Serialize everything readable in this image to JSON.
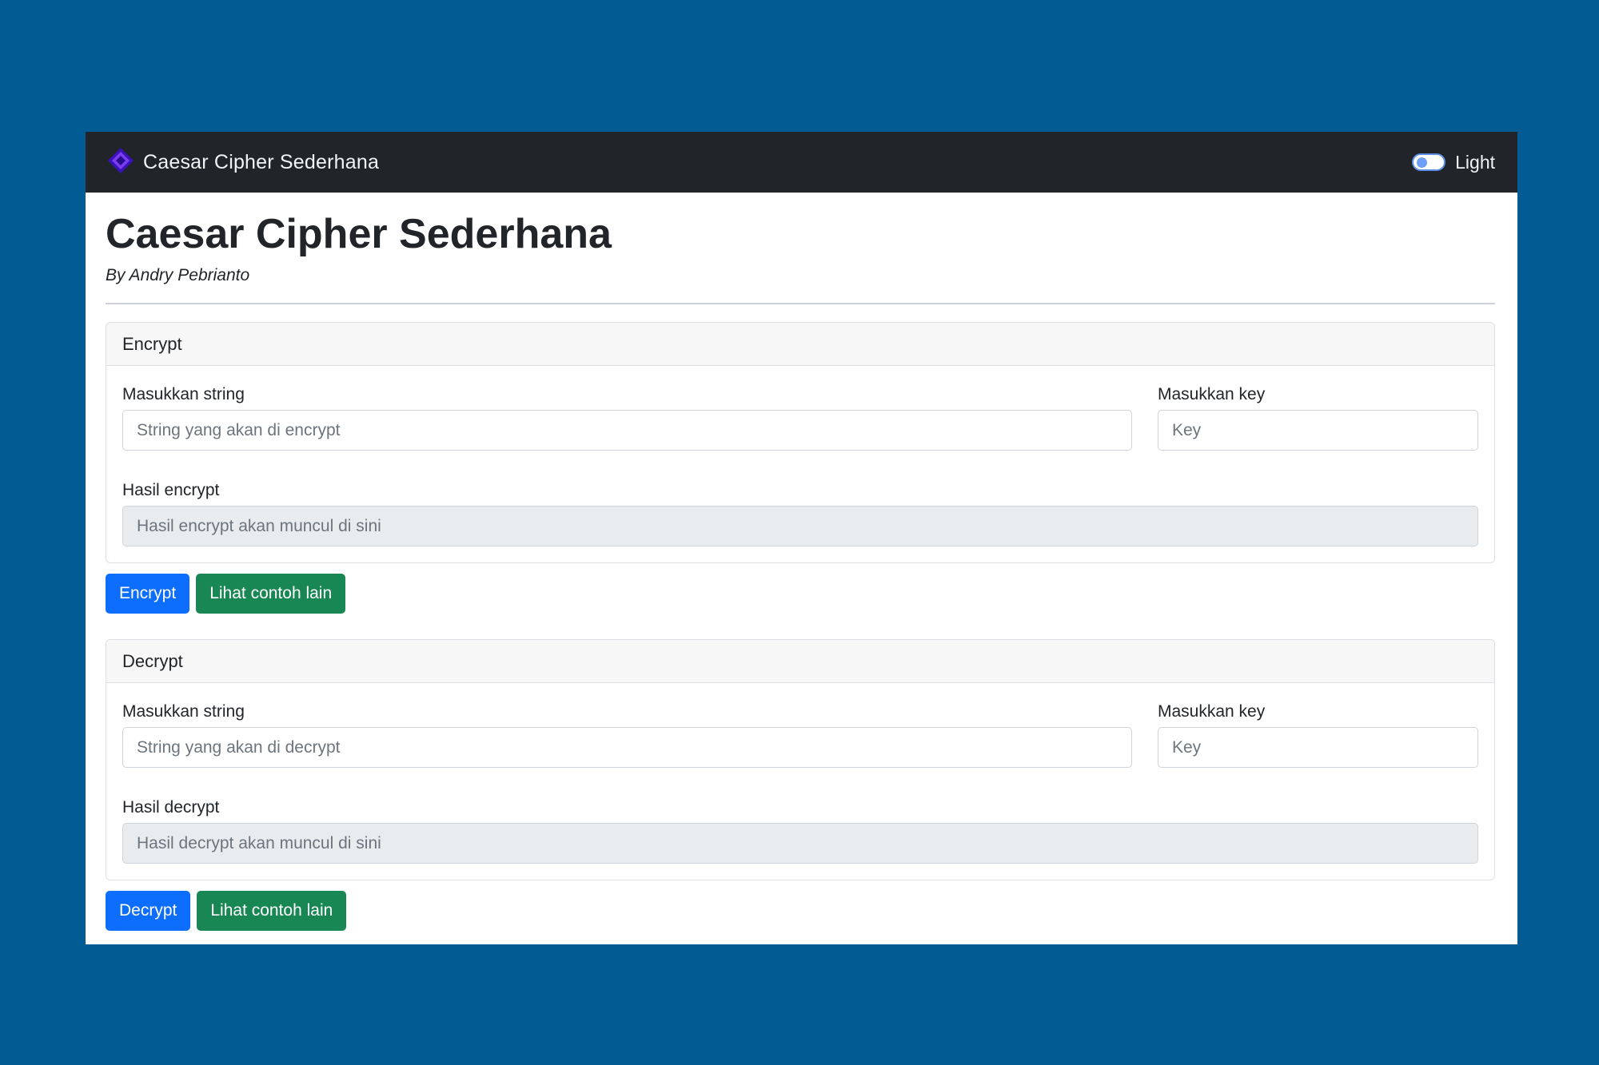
{
  "navbar": {
    "brand_title": "Caesar Cipher Sederhana",
    "brand_icon": "diamond-logo-icon",
    "theme_toggle_label": "Light",
    "colors": {
      "background": "#212529",
      "logo": "#5b2bd6"
    }
  },
  "header": {
    "title": "Caesar Cipher Sederhana",
    "author": "By Andry Pebrianto"
  },
  "encrypt": {
    "card_title": "Encrypt",
    "string_label": "Masukkan string",
    "string_placeholder": "String yang akan di encrypt",
    "string_value": "",
    "key_label": "Masukkan key",
    "key_placeholder": "Key",
    "key_value": "",
    "result_label": "Hasil encrypt",
    "result_placeholder": "Hasil encrypt akan muncul di sini",
    "result_value": "",
    "action_button": "Encrypt",
    "example_button": "Lihat contoh lain"
  },
  "decrypt": {
    "card_title": "Decrypt",
    "string_label": "Masukkan string",
    "string_placeholder": "String yang akan di decrypt",
    "string_value": "",
    "key_label": "Masukkan key",
    "key_placeholder": "Key",
    "key_value": "",
    "result_label": "Hasil decrypt",
    "result_placeholder": "Hasil decrypt akan muncul di sini",
    "result_value": "",
    "action_button": "Decrypt",
    "example_button": "Lihat contoh lain"
  },
  "colors": {
    "page_background": "#025c93",
    "primary": "#0d6efd",
    "success": "#198754"
  }
}
